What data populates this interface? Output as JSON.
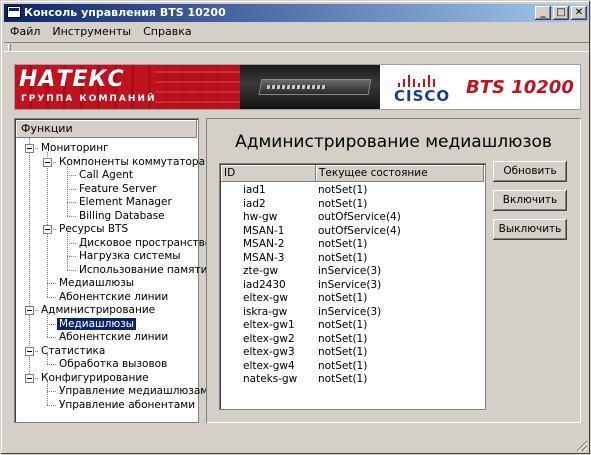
{
  "window": {
    "title": "Консоль управления BTS 10200"
  },
  "title_buttons": {
    "minimize": "_",
    "maximize": "□",
    "close": "✕"
  },
  "menu": [
    "Файл",
    "Инструменты",
    "Справка"
  ],
  "banner": {
    "company": "НАТЕКС",
    "company_sub": "ГРУППА КОМПАНИЙ",
    "vendor": "CISCO",
    "product": "BTS 10200",
    "colors": {
      "natex_red": "#c1121f",
      "cisco_blue": "#1a3c8c"
    }
  },
  "tree": {
    "header": "Функции",
    "items": [
      {
        "label": "Мониторинг",
        "level": 0,
        "expandable": true
      },
      {
        "label": "Компоненты коммутатора",
        "level": 1,
        "expandable": true
      },
      {
        "label": "Call Agent",
        "level": 2
      },
      {
        "label": "Feature Server",
        "level": 2
      },
      {
        "label": "Element Manager",
        "level": 2
      },
      {
        "label": "Billing Database",
        "level": 2
      },
      {
        "label": "Ресурсы BTS",
        "level": 1,
        "expandable": true
      },
      {
        "label": "Дисковое пространство",
        "level": 2
      },
      {
        "label": "Нагрузка системы",
        "level": 2
      },
      {
        "label": "Использование памяти",
        "level": 2
      },
      {
        "label": "Медиашлюзы",
        "level": 1
      },
      {
        "label": "Абонентские линии",
        "level": 1
      },
      {
        "label": "Администрирование",
        "level": 0,
        "expandable": true
      },
      {
        "label": "Медиашлюзы",
        "level": 1,
        "selected": true
      },
      {
        "label": "Абонентские линии",
        "level": 1
      },
      {
        "label": "Статистика",
        "level": 0,
        "expandable": true
      },
      {
        "label": "Обработка вызовов",
        "level": 1
      },
      {
        "label": "Конфигурирование",
        "level": 0,
        "expandable": true
      },
      {
        "label": "Управление медиашлюзами",
        "level": 1
      },
      {
        "label": "Управление абонентами",
        "level": 1
      }
    ]
  },
  "main": {
    "title": "Администрирование медиашлюзов",
    "columns": [
      "ID",
      "Текущее состояние"
    ],
    "rows": [
      [
        "iad1",
        "notSet(1)"
      ],
      [
        "iad2",
        "notSet(1)"
      ],
      [
        "hw-gw",
        "outOfService(4)"
      ],
      [
        "MSAN-1",
        "outOfService(4)"
      ],
      [
        "MSAN-2",
        "notSet(1)"
      ],
      [
        "MSAN-3",
        "notSet(1)"
      ],
      [
        "zte-gw",
        "inService(3)"
      ],
      [
        "iad2430",
        "inService(3)"
      ],
      [
        "eltex-gw",
        "notSet(1)"
      ],
      [
        "iskra-gw",
        "inService(3)"
      ],
      [
        "eltex-gw1",
        "notSet(1)"
      ],
      [
        "eltex-gw2",
        "notSet(1)"
      ],
      [
        "eltex-gw3",
        "notSet(1)"
      ],
      [
        "eltex-gw4",
        "notSet(1)"
      ],
      [
        "nateks-gw",
        "notSet(1)"
      ]
    ],
    "buttons": {
      "refresh": "Обновить",
      "enable": "Включить",
      "disable": "Выключить"
    }
  }
}
